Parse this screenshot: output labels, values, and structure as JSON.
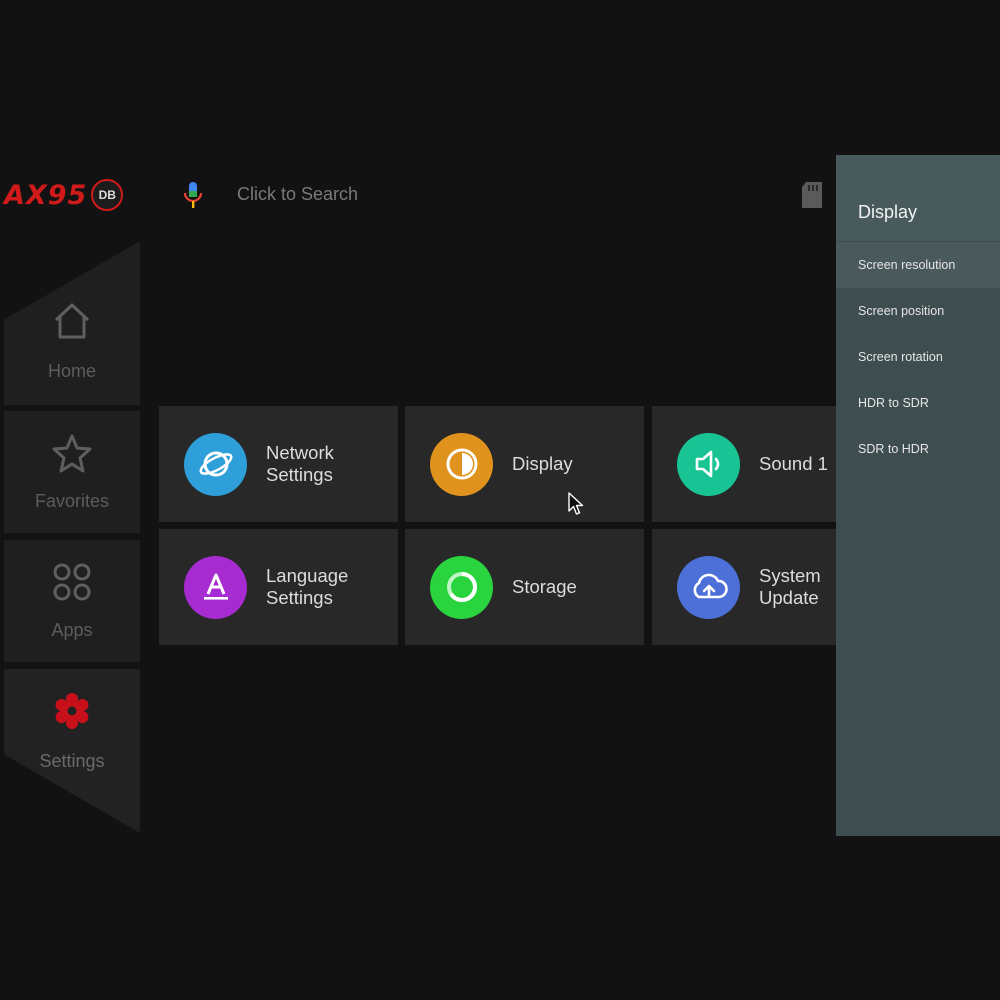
{
  "header": {
    "brand_text": "AX95",
    "brand_badge": "DB",
    "search_placeholder": "Click to Search"
  },
  "nav": {
    "home": "Home",
    "favorites": "Favorites",
    "apps": "Apps",
    "settings": "Settings"
  },
  "tiles": {
    "network_line1": "Network",
    "network_line2": "Settings",
    "display": "Display",
    "sound": "Sound 1",
    "language_line1": "Language",
    "language_line2": "Settings",
    "storage": "Storage",
    "update_line1": "System",
    "update_line2": "Update"
  },
  "panel": {
    "title": "Display",
    "items": [
      "Screen resolution",
      "Screen position",
      "Screen rotation",
      "HDR to SDR",
      "SDR to HDR"
    ]
  },
  "colors": {
    "brand": "#d11a1a",
    "network": "#2e9fd9",
    "display": "#e0931c",
    "sound": "#19c494",
    "language": "#a62bd0",
    "storage": "#29d43e",
    "update": "#4d6fd8",
    "panel_bg": "#3e4d4f"
  },
  "icons": [
    "home-icon",
    "star-icon",
    "apps-grid-icon",
    "gear-icon",
    "mic-icon",
    "sd-card-icon",
    "globe-icon",
    "contrast-icon",
    "speaker-icon",
    "font-icon",
    "storage-ring-icon",
    "cloud-upload-icon",
    "mouse-cursor-icon"
  ]
}
